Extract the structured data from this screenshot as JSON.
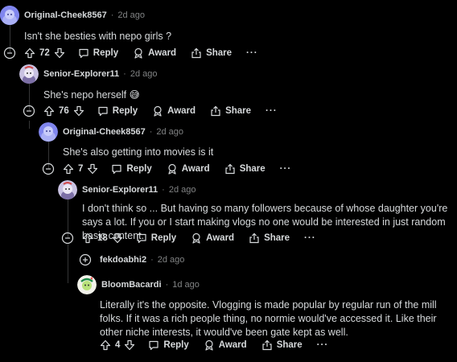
{
  "comments": [
    {
      "author": "Original-Cheek8567",
      "age": "2d ago",
      "text": "Isn't she besties with nepo girls ?",
      "score": "72",
      "reply_label": "Reply",
      "award_label": "Award",
      "share_label": "Share",
      "more_label": "···"
    },
    {
      "author": "Senior-Explorer11",
      "age": "2d ago",
      "text": "She's nepo herself 😅",
      "score": "76",
      "reply_label": "Reply",
      "award_label": "Award",
      "share_label": "Share",
      "more_label": "···"
    },
    {
      "author": "Original-Cheek8567",
      "age": "2d ago",
      "text": "She's also getting into movies is it",
      "score": "7",
      "reply_label": "Reply",
      "award_label": "Award",
      "share_label": "Share",
      "more_label": "···"
    },
    {
      "author": "Senior-Explorer11",
      "age": "2d ago",
      "text": "I don't think so ... But having so many followers because of whose daughter you're says a lot. If you or I start making vlogs no one would be interested in just random basic content.",
      "score": "18",
      "reply_label": "Reply",
      "award_label": "Award",
      "share_label": "Share",
      "more_label": "···"
    },
    {
      "author": "fekdoabhi2",
      "age": "2d ago"
    },
    {
      "author": "BloomBacardi",
      "age": "1d ago",
      "text": "Literally it's the opposite. Vlogging is made popular by regular run of the mill folks. If it was a rich people thing, no normie would've accessed it. Like their other niche interests, it would've been gate kept as well.",
      "score": "4",
      "reply_label": "Reply",
      "award_label": "Award",
      "share_label": "Share",
      "more_label": "···"
    }
  ],
  "colors": {
    "background": "#000000",
    "text": "#d7dadc",
    "muted": "#818384",
    "thread_line": "#343536"
  }
}
